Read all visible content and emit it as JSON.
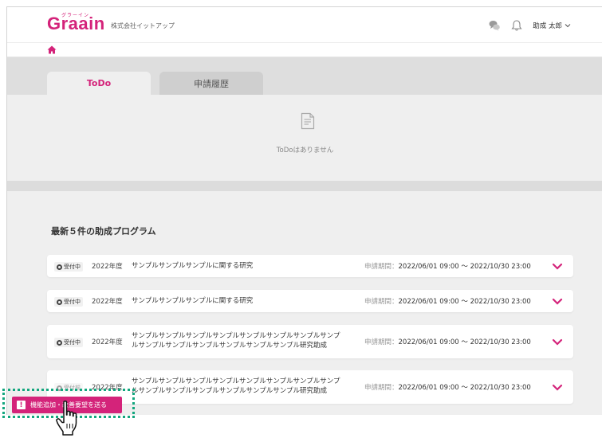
{
  "header": {
    "logo": "Graain",
    "logo_ruby": "グラーイン",
    "company": "株式会社イットアップ",
    "user_name": "助成 太郎",
    "chat_icon": "chat-bubbles-icon",
    "bell_icon": "bell-icon",
    "dropdown_icon": "chevron-down-icon"
  },
  "breadcrumb": {
    "home_icon": "home-icon"
  },
  "tabs": [
    {
      "label": "ToDo",
      "active": true
    },
    {
      "label": "申請履歴",
      "active": false
    }
  ],
  "todo": {
    "empty_icon": "document-icon",
    "empty_message": "ToDoはありません"
  },
  "programs": {
    "title": "最新５件の助成プログラム",
    "period_label": "申請期間：",
    "items": [
      {
        "status": "受付中",
        "year": "2022年度",
        "title": "サンプルサンプルサンプルに関する研究",
        "period": "2022/06/01 09:00 ～ 2022/10/30 23:00"
      },
      {
        "status": "受付中",
        "year": "2022年度",
        "title": "サンプルサンプルサンプルに関する研究",
        "period": "2022/06/01 09:00 ～ 2022/10/30 23:00"
      },
      {
        "status": "受付中",
        "year": "2022年度",
        "title_line1": "サンプルサンプルサンプルサンプルサンプルサンプルサンプルサンプ",
        "title_line2": "ルサンプルサンプルサンプルサンプルサンプルサンプル研究助成",
        "period": "2022/06/01 09:00 ～ 2022/10/30 23:00"
      },
      {
        "status": "受付前",
        "year": "2022年度",
        "title_line1": "サンプルサンプルサンプルサンプルサンプルサンプルサンプルサンプ",
        "title_line2": "ルサンプルサンプルサンプルサンプルサンプルサンプル研究助成",
        "period": "2022/06/01 09:00 ～ 2022/10/30 23:00"
      }
    ]
  },
  "feedback_button": {
    "label": "機能追加・改善要望を送る",
    "icon": "exclamation-icon",
    "icon_glyph": "!"
  },
  "colors": {
    "brand": "#d4237a",
    "highlight": "#13a67e",
    "background": "#efefef"
  },
  "cursor_icon": "hand-pointer-icon"
}
